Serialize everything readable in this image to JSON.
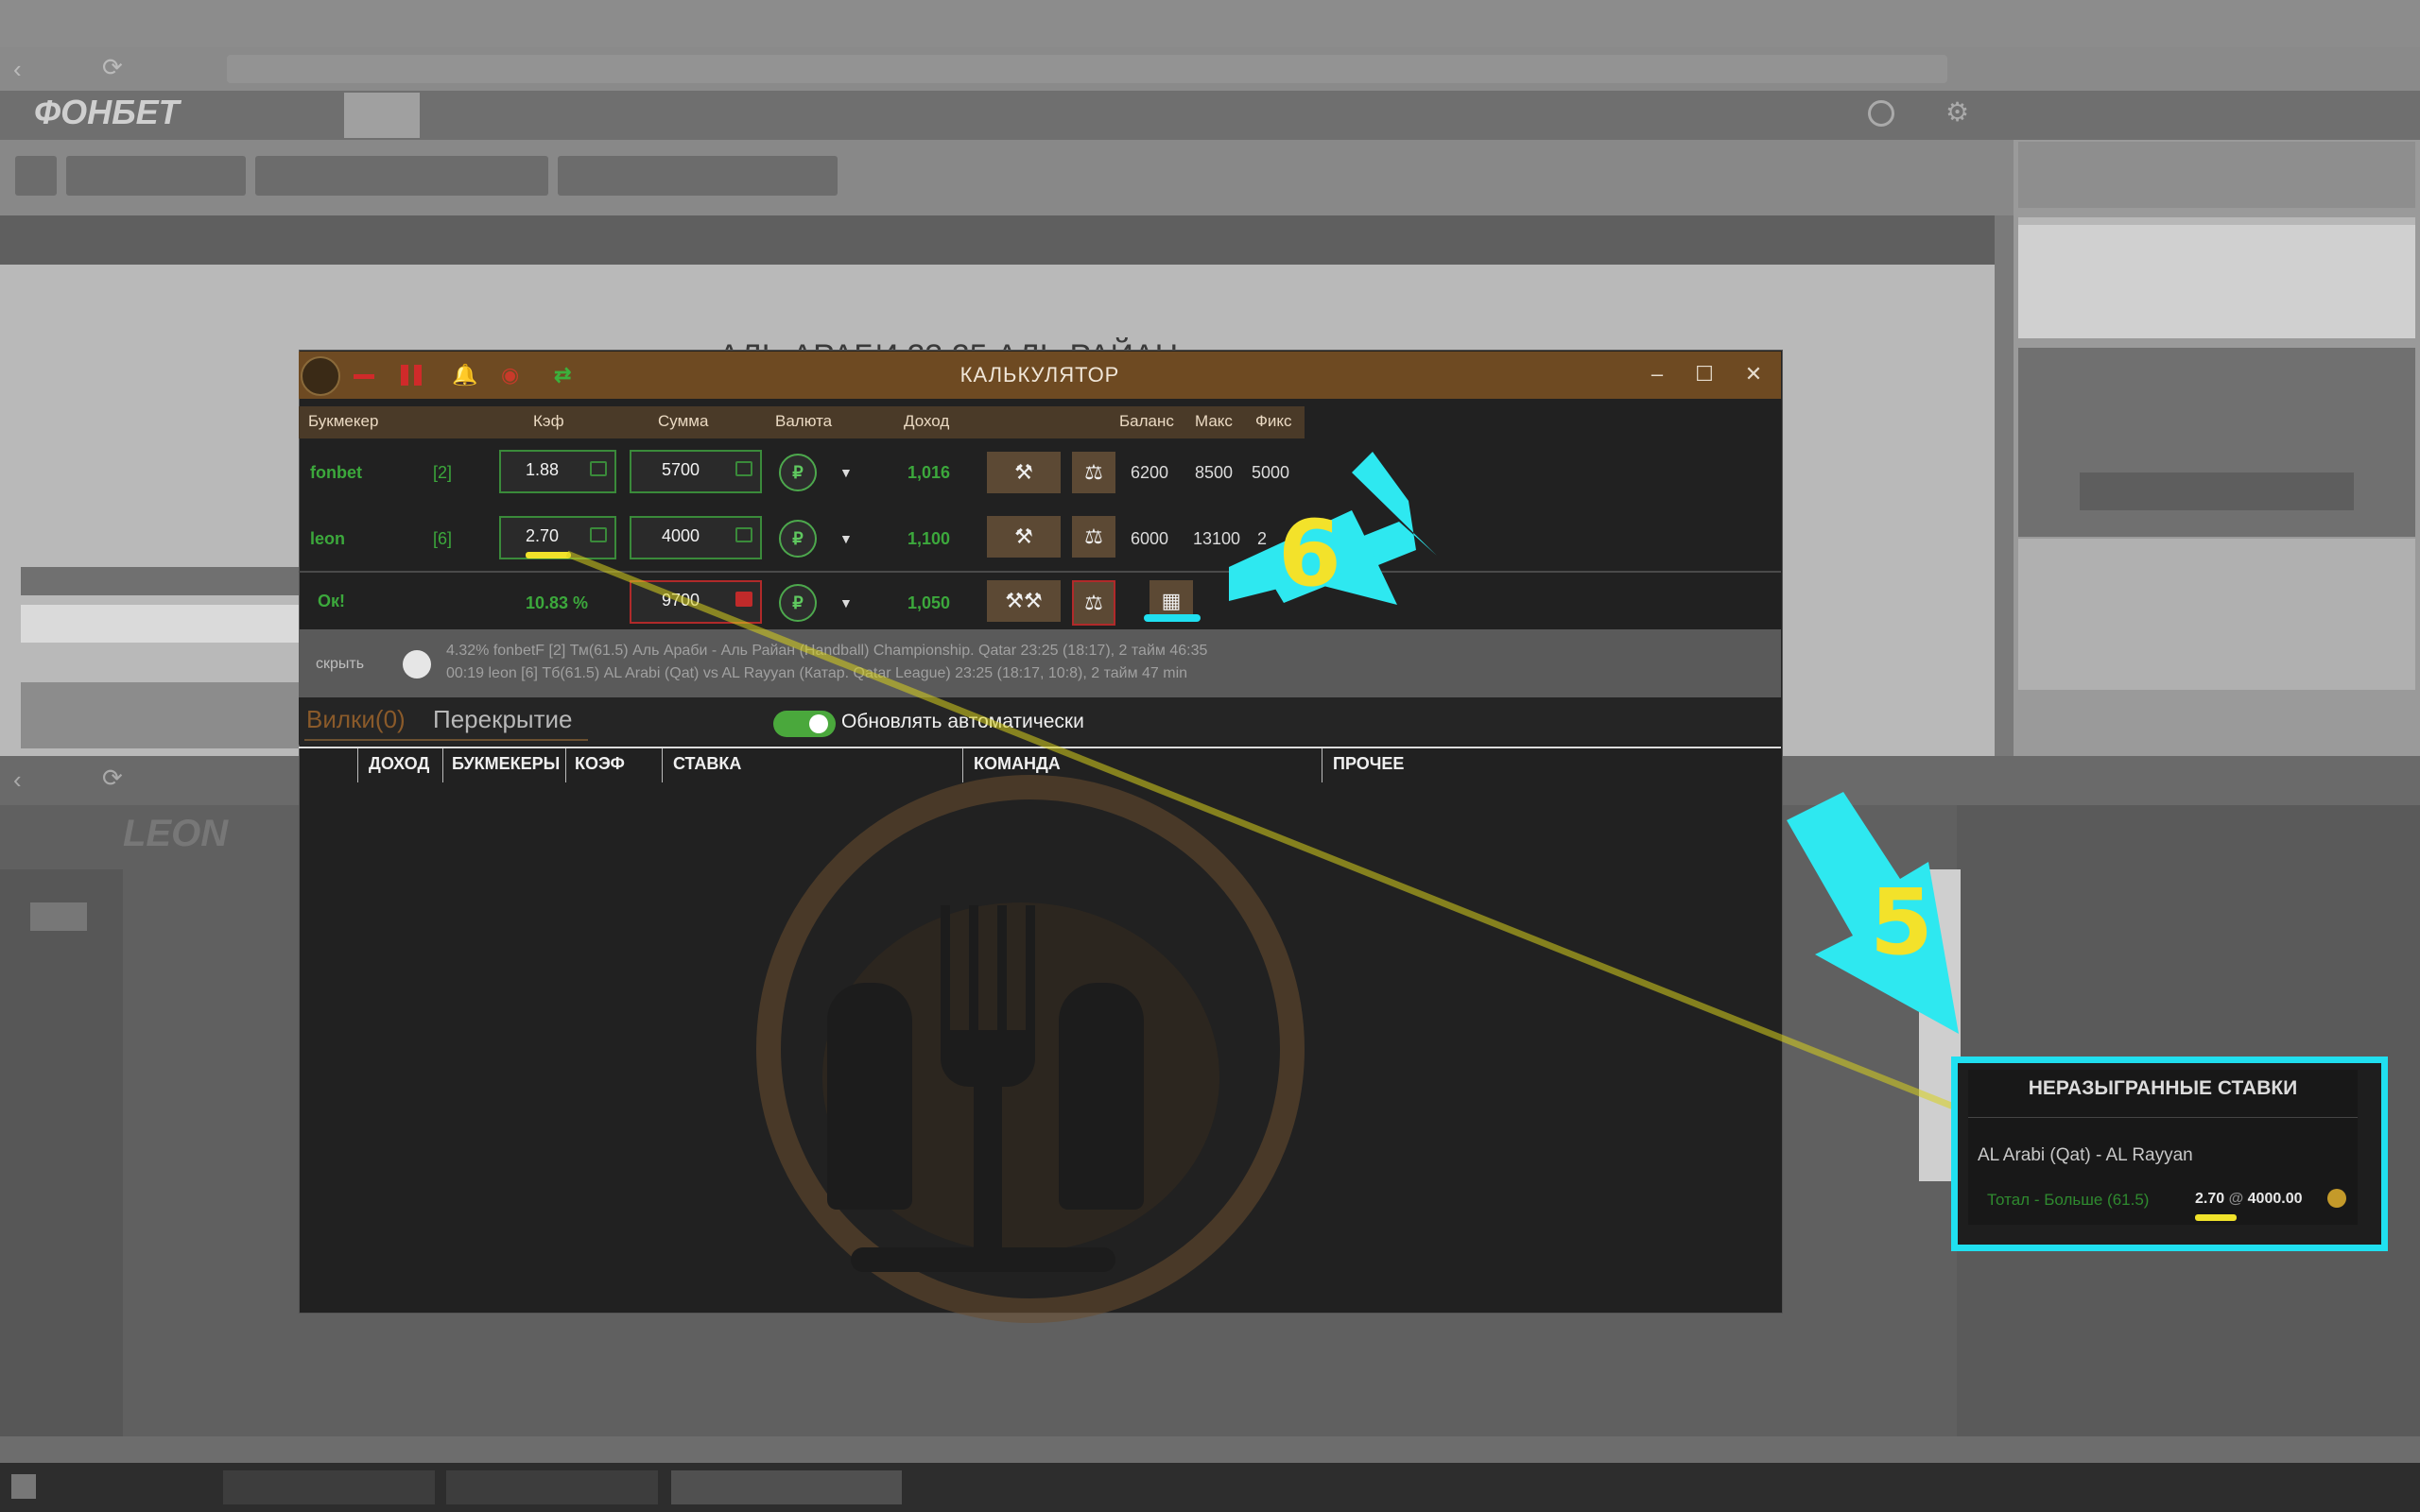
{
  "calculator": {
    "title": "КАЛЬКУЛЯТОР",
    "headers": {
      "bookmaker": "Букмекер",
      "odds": "Кэф",
      "sum": "Сумма",
      "currency": "Валюта",
      "income": "Доход",
      "balance": "Баланс",
      "max": "Макс",
      "fix": "Фикс"
    },
    "rows": [
      {
        "bookmaker": "fonbet",
        "num": "[2]",
        "odds": "1.88",
        "sum": "5700",
        "currency": "₽",
        "income": "1,016",
        "balance": "6200",
        "max": "8500",
        "fix": "5000"
      },
      {
        "bookmaker": "leon",
        "num": "[6]",
        "odds": "2.70",
        "sum": "4000",
        "currency": "₽",
        "income": "1,100",
        "balance": "6000",
        "max": "13100",
        "fix": "2"
      }
    ],
    "total": {
      "status": "Ок!",
      "percent": "10.83 %",
      "sum": "9700",
      "currency": "₽",
      "income": "1,050"
    },
    "fork_row": {
      "btn": "скрыть",
      "line1": "4.32%   fonbetF [2]   Тм(61.5)   Аль Араби - Аль Райан (Handball) Championship. Qatar 23:25 (18:17), 2 тайм  46:35",
      "line2": "00:19   leon   [6]   Тб(61.5)   AL Arabi (Qat) vs AL Rayyan (Катар. Qatar League) 23:25 (18:17, 10:8), 2 тайм  47 min"
    },
    "tabs": {
      "forks": "Вилки(0)",
      "overlap": "Перекрытие"
    },
    "auto_update_label": "Обновлять автоматически",
    "table_headers": [
      "ДОХОД",
      "БУКМЕКЕРЫ",
      "КОЭФ",
      "СТАВКА",
      "КОМАНДА",
      "ПРОЧЕЕ"
    ]
  },
  "background": {
    "logo": "ФОНБЕТ",
    "score_text": "АЛЬ АРАБИ   23   25   АЛЬ РАЙАН",
    "leon_logo": "LEON"
  },
  "annotations": {
    "arrow6": "6",
    "arrow5": "5"
  },
  "popup": {
    "title": "НЕРАЗЫГРАННЫЕ СТАВКИ",
    "match": "AL Arabi (Qat) - AL Rayyan",
    "bet": "Тотал - Больше (61.5)",
    "odds": "2.70",
    "at": "@",
    "stake": "4000.00"
  },
  "icons": [
    "app-logo-icon",
    "minus-icon",
    "pause-icon",
    "bell-icon",
    "eye-slash-icon",
    "refresh-icon",
    "minimize-icon",
    "maximize-icon",
    "close-icon",
    "hammer-icon",
    "scales-icon",
    "calendar-icon",
    "rub-icon",
    "chevron-down-icon",
    "lock-icon"
  ],
  "colors": {
    "title_bar": "#6e4a22",
    "accent_green": "#3ca83c",
    "danger": "#b02a2a",
    "highlight_cyan": "#20e0f0",
    "highlight_yellow": "#f3e22a"
  }
}
